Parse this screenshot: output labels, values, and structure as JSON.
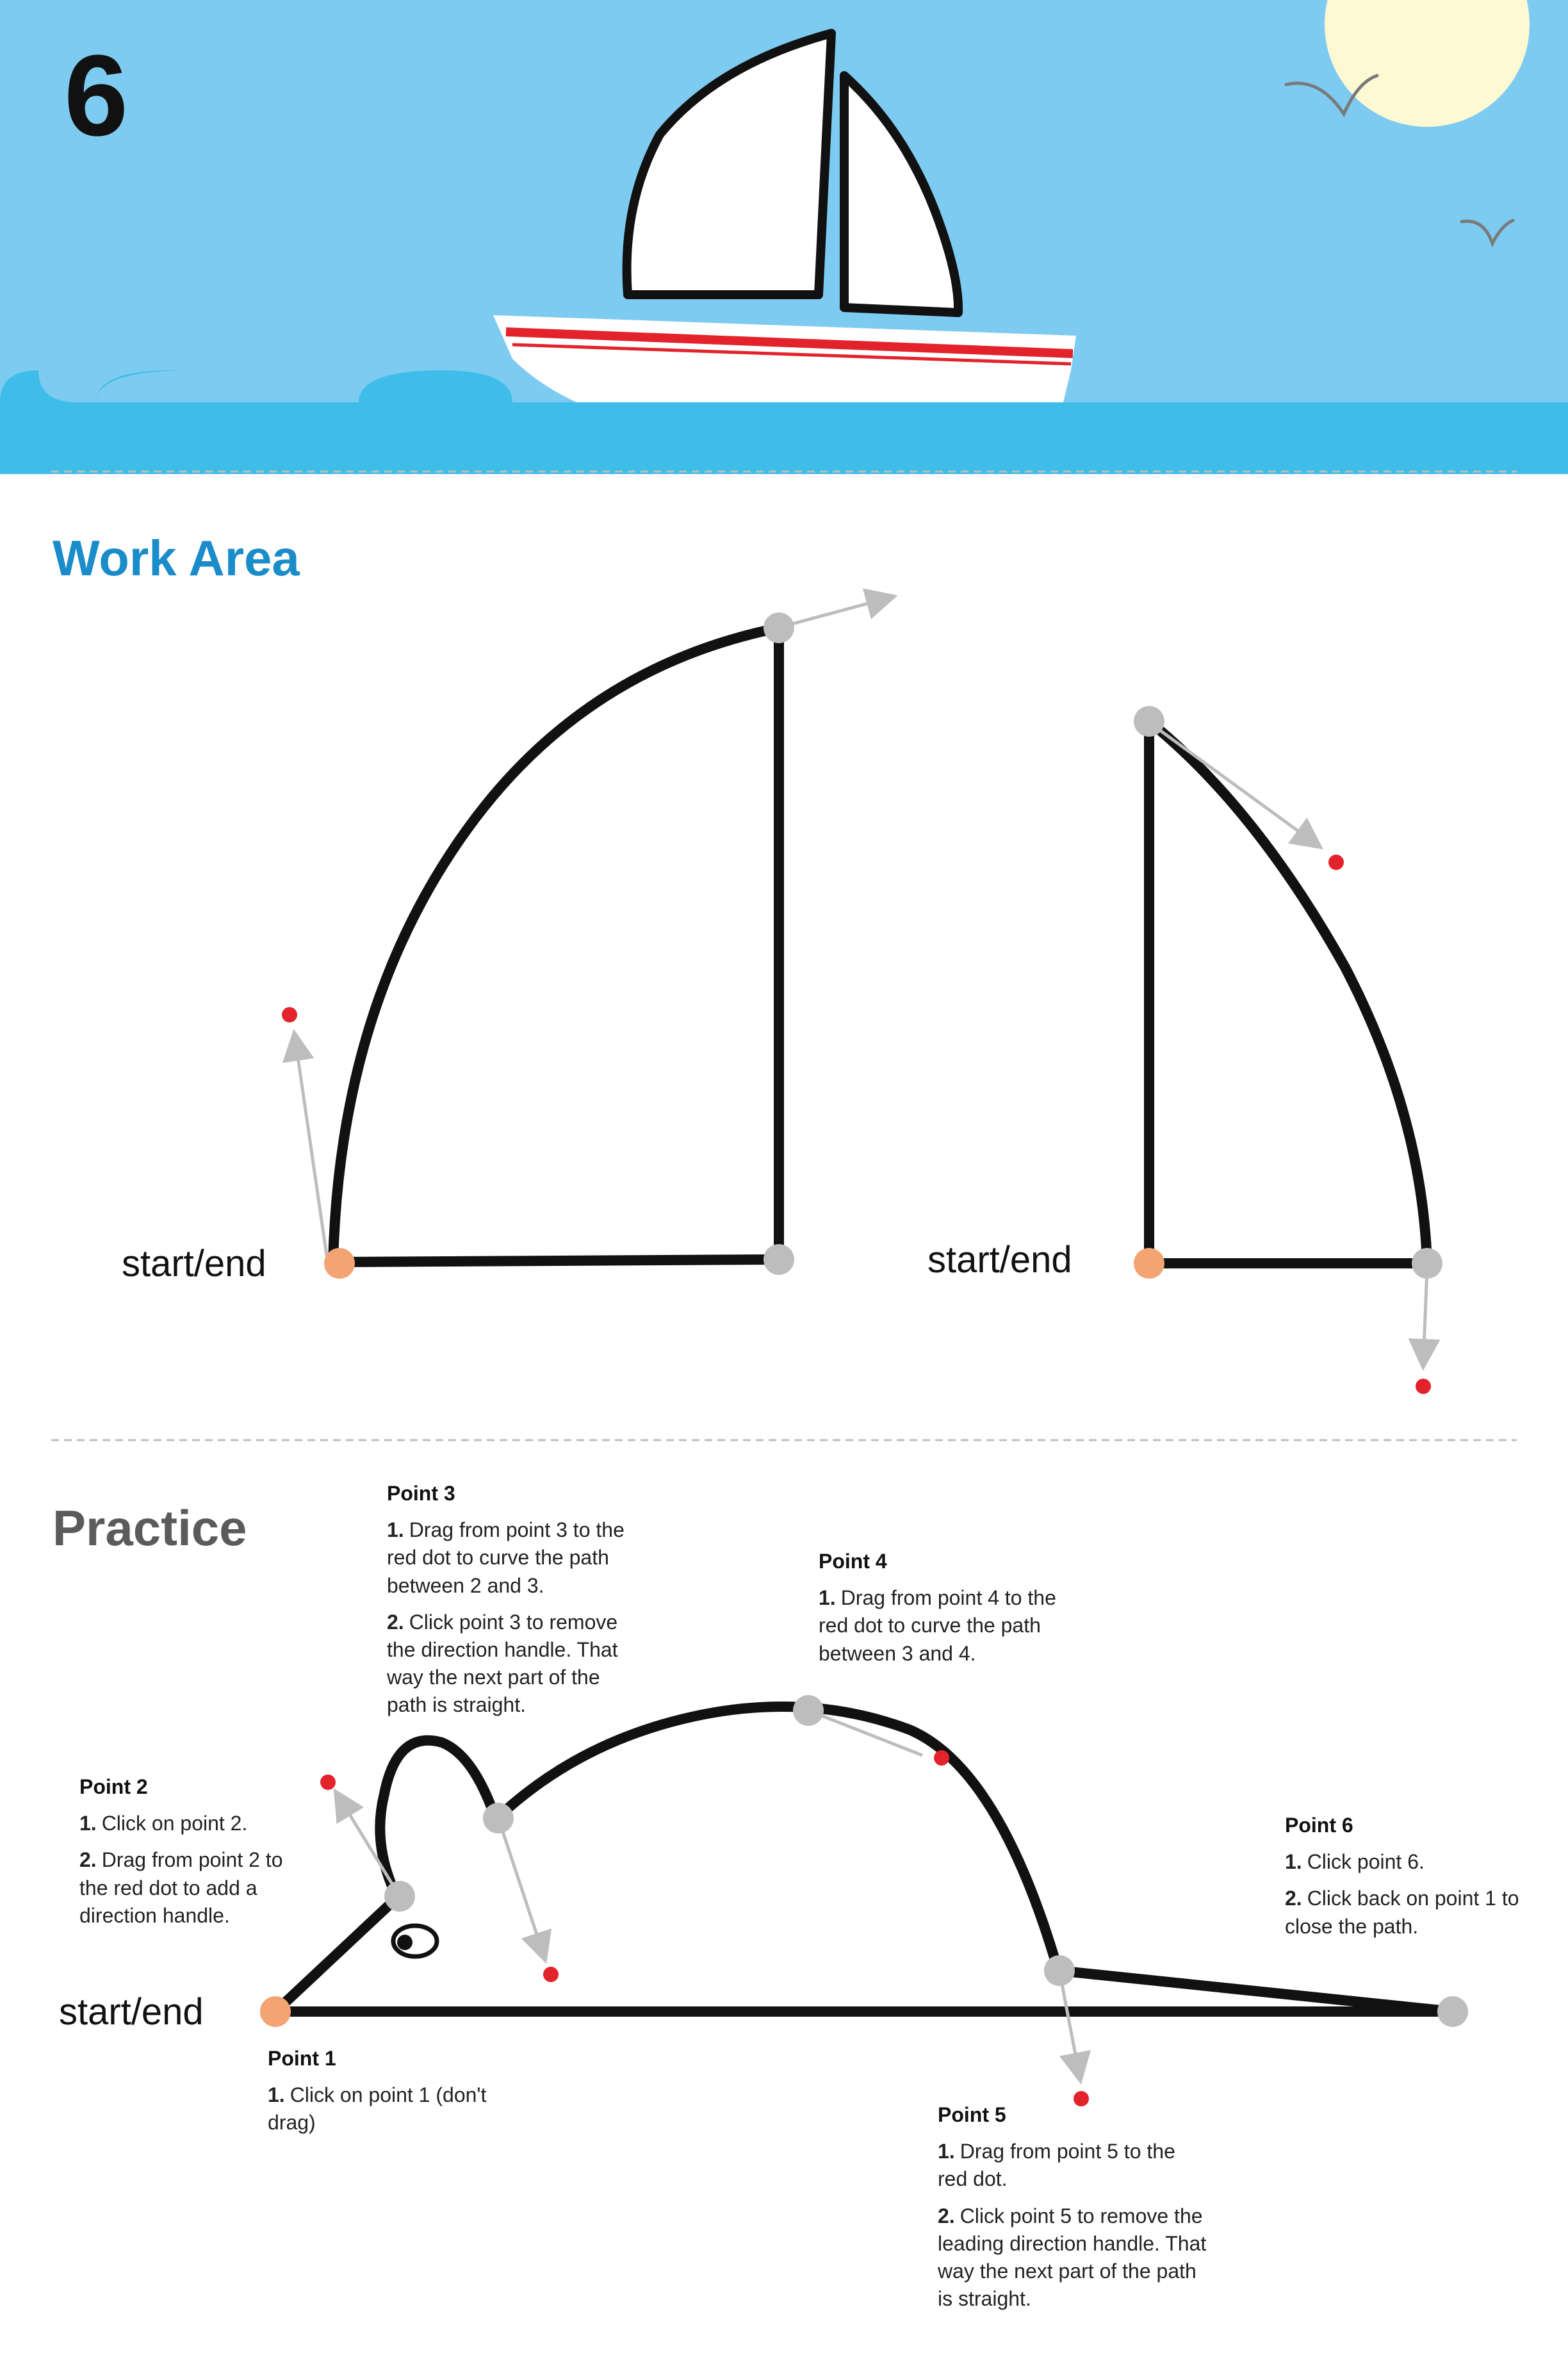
{
  "page_number": "6",
  "colors": {
    "sky": "#7ecbf1",
    "sea": "#3fbde9",
    "sun": "#fdf9d3",
    "section_blue": "#1a8cc9",
    "section_gray": "#5b5b5b",
    "anchor_start": "#f4a373",
    "anchor": "#bdbdbd",
    "handle_dot": "#e3232b"
  },
  "work_area": {
    "title": "Work Area",
    "shape1_label": "start/end",
    "shape2_label": "start/end"
  },
  "practice": {
    "title": "Practice",
    "start_label": "start/end",
    "points": {
      "p1": {
        "title": "Point 1",
        "steps": [
          {
            "num": "1.",
            "text": "Click on point 1 (don't drag)"
          }
        ]
      },
      "p2": {
        "title": "Point 2",
        "steps": [
          {
            "num": "1.",
            "text": "Click on point 2."
          },
          {
            "num": "2.",
            "text": "Drag from point 2 to the red dot to add a direction handle."
          }
        ]
      },
      "p3": {
        "title": "Point 3",
        "steps": [
          {
            "num": "1.",
            "text": "Drag from point 3 to the red dot to curve the path between 2 and 3."
          },
          {
            "num": "2.",
            "text": "Click point 3 to remove the direction handle. That way the next part of the path is straight."
          }
        ]
      },
      "p4": {
        "title": "Point 4",
        "steps": [
          {
            "num": "1.",
            "text": "Drag from point 4 to the red dot to curve the path between 3 and 4."
          }
        ]
      },
      "p5": {
        "title": "Point 5",
        "steps": [
          {
            "num": "1.",
            "text": "Drag from point 5 to the red dot."
          },
          {
            "num": "2.",
            "text": "Click point 5 to remove the leading direction handle. That way the next part of the path is straight."
          }
        ]
      },
      "p6": {
        "title": "Point 6",
        "steps": [
          {
            "num": "1.",
            "text": "Click point 6."
          },
          {
            "num": "2.",
            "text": "Click back on point 1 to close the path."
          }
        ]
      }
    }
  }
}
